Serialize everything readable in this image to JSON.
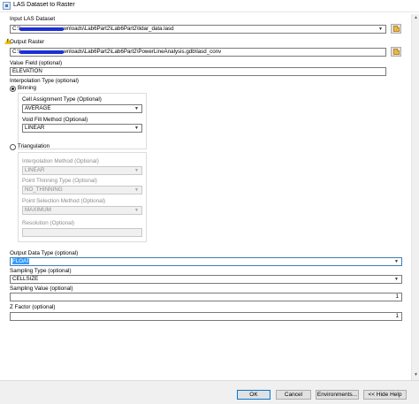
{
  "window": {
    "title": "LAS Dataset to Raster"
  },
  "form": {
    "input_las": {
      "label": "Input LAS Dataset",
      "value_prefix": "C:\\L",
      "value_suffix": "wnloads\\Lab6Part2\\Lab6Part2\\lidar_data.lasd"
    },
    "output_raster": {
      "label": "Output Raster",
      "value_prefix": "C:\\L",
      "value_suffix": "wnloads\\Lab6Part2\\Lab6Part2\\PowerLineAnalysis.gdb\\lasd_conv"
    },
    "value_field": {
      "label": "Value Field (optional)",
      "value": "ELEVATION"
    },
    "interpolation": {
      "label": "Interpolation Type (optional)",
      "selected": "Binning",
      "binning": {
        "label": "Binning",
        "cell_assignment": {
          "label": "Cell Assignment Type (Optional)",
          "value": "AVERAGE"
        },
        "void_fill": {
          "label": "Void Fill Method (Optional)",
          "value": "LINEAR"
        }
      },
      "triangulation": {
        "label": "Triangulation",
        "method": {
          "label": "Interpolation Method (Optional)",
          "value": "LINEAR"
        },
        "thinning_type": {
          "label": "Point Thinning Type (Optional)",
          "value": "NO_THINNING"
        },
        "selection_method": {
          "label": "Point Selection Method (Optional)",
          "value": "MAXIMUM"
        },
        "resolution": {
          "label": "Resolution (Optional)",
          "value": ""
        }
      }
    },
    "output_data_type": {
      "label": "Output Data Type (optional)",
      "value": "FLOAT"
    },
    "sampling_type": {
      "label": "Sampling Type (optional)",
      "value": "CELLSIZE"
    },
    "sampling_value": {
      "label": "Sampling Value (optional)",
      "value": "1"
    },
    "z_factor": {
      "label": "Z Factor (optional)",
      "value": "1"
    }
  },
  "buttons": {
    "ok": "OK",
    "cancel": "Cancel",
    "environments": "Environments...",
    "hide_help": "<< Hide Help"
  },
  "icons": {
    "window": "toolbox-icon",
    "browse": "folder-icon",
    "warning": "warning-icon"
  },
  "colors": {
    "redaction": "#1c2fd6",
    "selection": "#3399ff",
    "warning": "#f2c200"
  }
}
